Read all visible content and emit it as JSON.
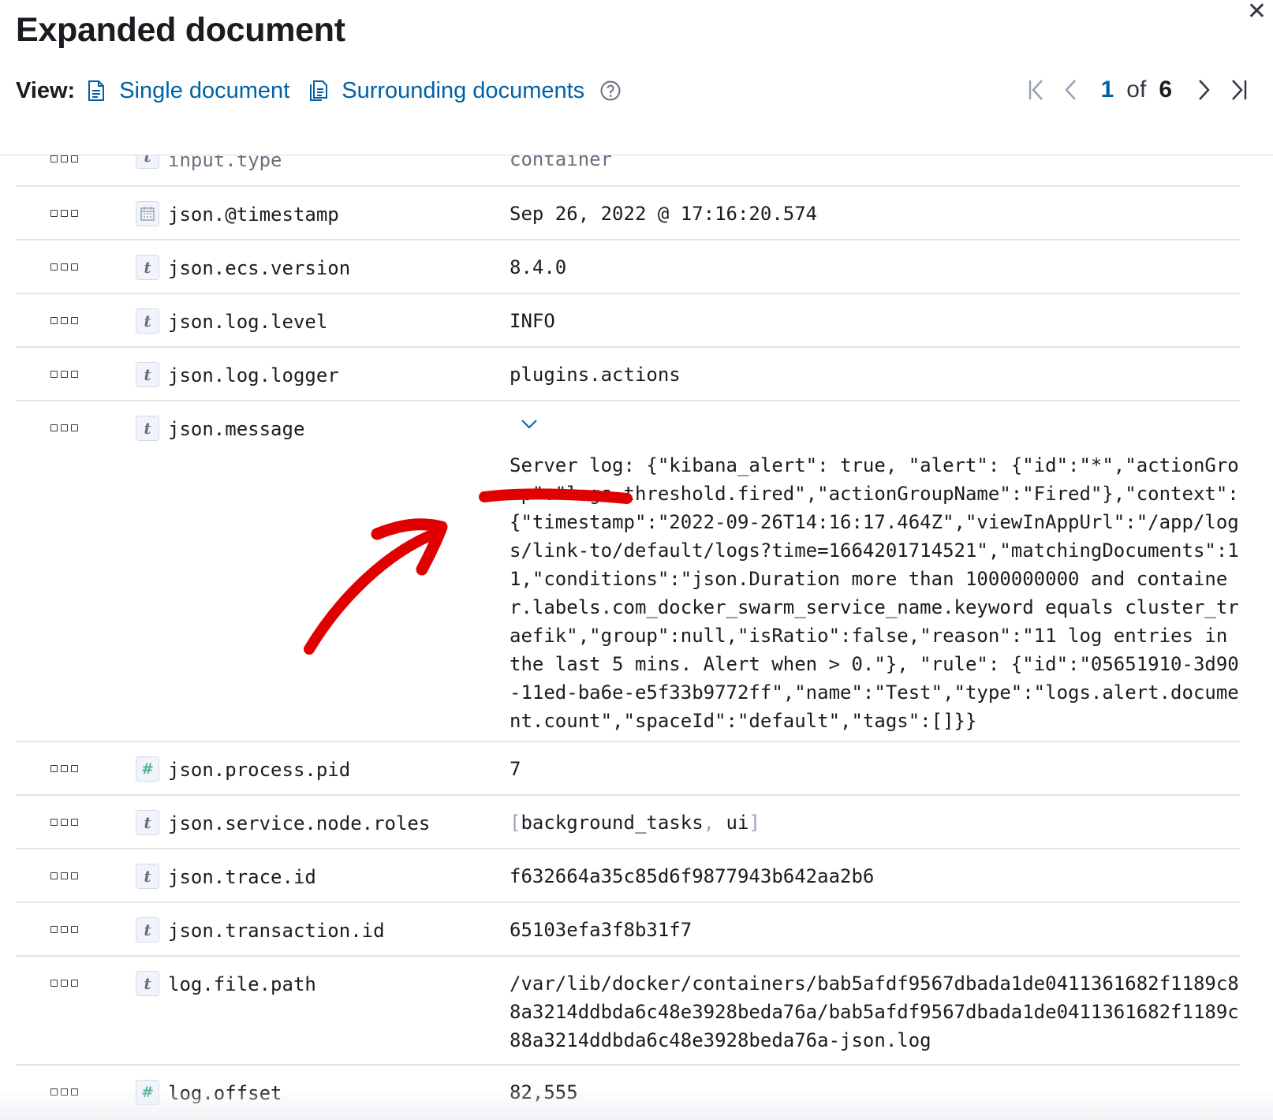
{
  "header": {
    "title": "Expanded document",
    "view_label": "View:",
    "single_doc_label": "Single document",
    "surrounding_docs_label": "Surrounding documents",
    "pager": {
      "current": "1",
      "of": "of",
      "total": "6"
    }
  },
  "fields": {
    "input_type": {
      "name": "input.type",
      "value": "container"
    },
    "timestamp": {
      "name": "json.@timestamp",
      "value": "Sep 26, 2022 @ 17:16:20.574"
    },
    "ecs_version": {
      "name": "json.ecs.version",
      "value": "8.4.0"
    },
    "log_level": {
      "name": "json.log.level",
      "value": "INFO"
    },
    "log_logger": {
      "name": "json.log.logger",
      "value": "plugins.actions"
    },
    "message": {
      "name": "json.message",
      "value": "Server log: {\"kibana_alert\": true, \"alert\": {\"id\":\"*\",\"actionGroup\":\"logs.threshold.fired\",\"actionGroupName\":\"Fired\"},\"context\":{\"timestamp\":\"2022-09-26T14:16:17.464Z\",\"viewInAppUrl\":\"/app/logs/link-to/default/logs?time=1664201714521\",\"matchingDocuments\":11,\"conditions\":\"json.Duration more than 1000000000 and container.labels.com_docker_swarm_service_name.keyword equals cluster_traefik\",\"group\":null,\"isRatio\":false,\"reason\":\"11 log entries in the last 5 mins. Alert when > 0.\"}, \"rule\": {\"id\":\"05651910-3d90-11ed-ba6e-e5f33b9772ff\",\"name\":\"Test\",\"type\":\"logs.alert.document.count\",\"spaceId\":\"default\",\"tags\":[]}}"
    },
    "process_pid": {
      "name": "json.process.pid",
      "value": "7"
    },
    "node_roles": {
      "name": "json.service.node.roles",
      "open": "[",
      "item1": "background_tasks",
      "sep": ",",
      "item2": "ui",
      "close": "]"
    },
    "trace_id": {
      "name": "json.trace.id",
      "value": "f632664a35c85d6f9877943b642aa2b6"
    },
    "transaction_id": {
      "name": "json.transaction.id",
      "value": "65103efa3f8b31f7"
    },
    "file_path": {
      "name": "log.file.path",
      "value": "/var/lib/docker/containers/bab5afdf9567dbada1de0411361682f1189c88a3214ddbda6c48e3928beda76a/bab5afdf9567dbada1de0411361682f1189c88a3214ddbda6c48e3928beda76a-json.log"
    },
    "log_offset": {
      "name": "log.offset",
      "value": "82,555"
    }
  },
  "type_badges": {
    "text": "t",
    "number": "#"
  },
  "icons": {
    "close": "close-icon",
    "document": "document-icon",
    "documents": "documents-icon",
    "help": "help-icon",
    "first": "pager-first-icon",
    "prev": "pager-prev-icon",
    "next": "pager-next-icon",
    "last": "pager-last-icon",
    "actions": "field-actions-icon",
    "date": "calendar-icon",
    "expand": "chevron-down-icon"
  },
  "annotation_color": "#e00000",
  "accent_color": "#0061a6"
}
